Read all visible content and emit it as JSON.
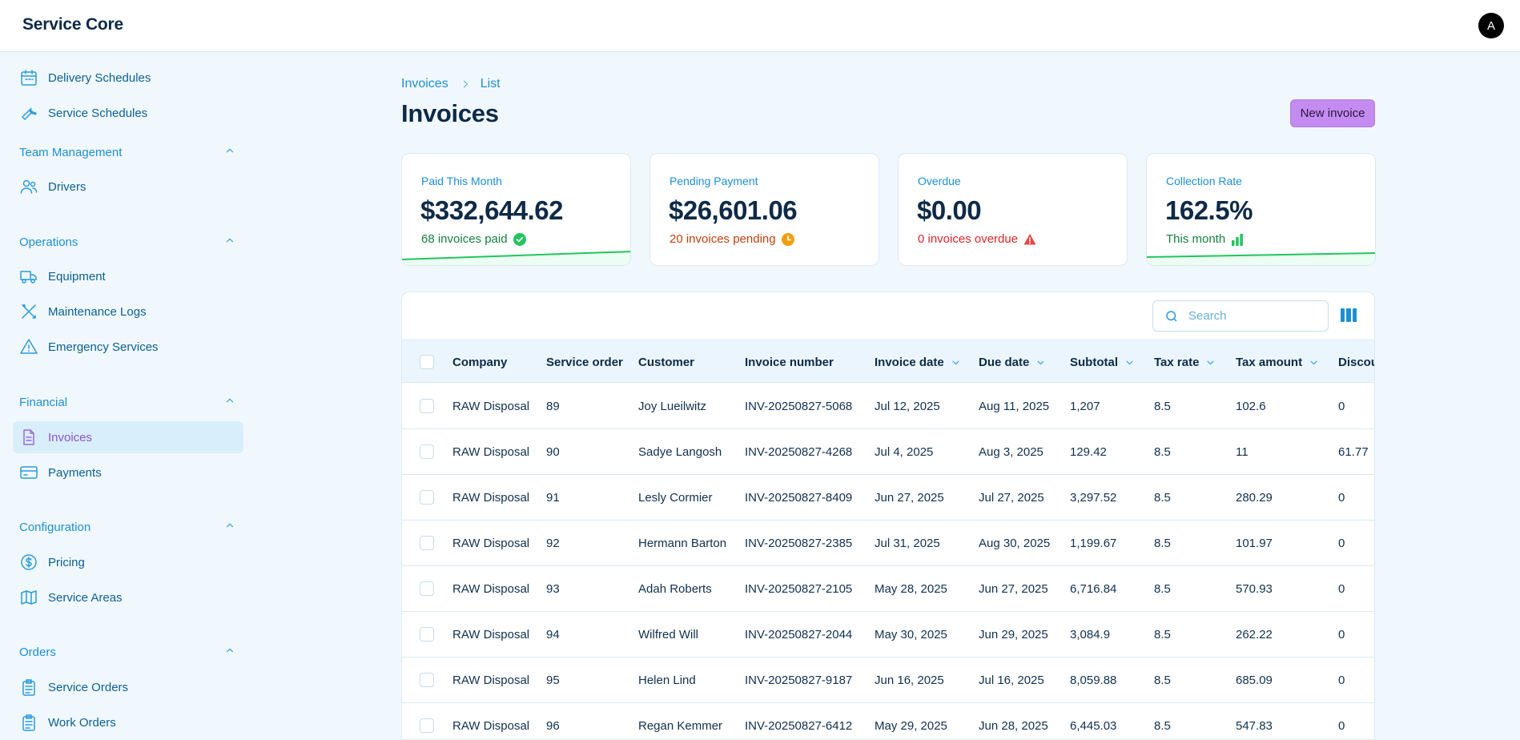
{
  "app": {
    "title": "Service Core",
    "avatar_initial": "A"
  },
  "sidebar": {
    "items_top": [
      {
        "label": "Delivery Schedules",
        "icon": "calendar-icon"
      },
      {
        "label": "Service Schedules",
        "icon": "wrench-icon"
      }
    ],
    "sections": [
      {
        "label": "Team Management",
        "items": [
          {
            "label": "Drivers",
            "icon": "users-icon"
          }
        ]
      },
      {
        "label": "Operations",
        "items": [
          {
            "label": "Equipment",
            "icon": "truck-icon"
          },
          {
            "label": "Maintenance Logs",
            "icon": "tools-icon"
          },
          {
            "label": "Emergency Services",
            "icon": "alert-triangle-icon"
          }
        ]
      },
      {
        "label": "Financial",
        "items": [
          {
            "label": "Invoices",
            "icon": "document-icon",
            "active": true
          },
          {
            "label": "Payments",
            "icon": "credit-card-icon"
          }
        ]
      },
      {
        "label": "Configuration",
        "items": [
          {
            "label": "Pricing",
            "icon": "dollar-circle-icon"
          },
          {
            "label": "Service Areas",
            "icon": "map-icon"
          }
        ]
      },
      {
        "label": "Orders",
        "items": [
          {
            "label": "Service Orders",
            "icon": "clipboard-icon"
          },
          {
            "label": "Work Orders",
            "icon": "clipboard-list-icon"
          }
        ]
      }
    ]
  },
  "breadcrumb": {
    "root": "Invoices",
    "current": "List"
  },
  "page": {
    "title": "Invoices",
    "new_button": "New invoice"
  },
  "stats": [
    {
      "label": "Paid This Month",
      "value": "$332,644.62",
      "sub": "68 invoices paid",
      "sub_color": "#15803d",
      "icon": "check-circle-icon"
    },
    {
      "label": "Pending Payment",
      "value": "$26,601.06",
      "sub": "20 invoices pending",
      "sub_color": "#c2410c",
      "icon": "clock-icon"
    },
    {
      "label": "Overdue",
      "value": "$0.00",
      "sub": "0 invoices overdue",
      "sub_color": "#dc2626",
      "icon": "warning-icon"
    },
    {
      "label": "Collection Rate",
      "value": "162.5%",
      "sub": "This month",
      "sub_color": "#15803d",
      "icon": "bar-chart-icon"
    }
  ],
  "colors": {
    "accent": "#1d8fd3",
    "button": "#c48bf0",
    "active_nav": "#8a55c9",
    "spark": "#22c55e"
  },
  "table": {
    "search_placeholder": "Search",
    "columns": [
      {
        "label": "Company",
        "sortable": false
      },
      {
        "label": "Service order",
        "sortable": false
      },
      {
        "label": "Customer",
        "sortable": false
      },
      {
        "label": "Invoice number",
        "sortable": false
      },
      {
        "label": "Invoice date",
        "sortable": true
      },
      {
        "label": "Due date",
        "sortable": true
      },
      {
        "label": "Subtotal",
        "sortable": true
      },
      {
        "label": "Tax rate",
        "sortable": true
      },
      {
        "label": "Tax amount",
        "sortable": true
      },
      {
        "label": "Discou",
        "sortable": false
      }
    ],
    "rows": [
      [
        "RAW Disposal",
        "89",
        "Joy Lueilwitz",
        "INV-20250827-5068",
        "Jul 12, 2025",
        "Aug 11, 2025",
        "1,207",
        "8.5",
        "102.6",
        "0"
      ],
      [
        "RAW Disposal",
        "90",
        "Sadye Langosh",
        "INV-20250827-4268",
        "Jul 4, 2025",
        "Aug 3, 2025",
        "129.42",
        "8.5",
        "11",
        "61.77"
      ],
      [
        "RAW Disposal",
        "91",
        "Lesly Cormier",
        "INV-20250827-8409",
        "Jun 27, 2025",
        "Jul 27, 2025",
        "3,297.52",
        "8.5",
        "280.29",
        "0"
      ],
      [
        "RAW Disposal",
        "92",
        "Hermann Barton",
        "INV-20250827-2385",
        "Jul 31, 2025",
        "Aug 30, 2025",
        "1,199.67",
        "8.5",
        "101.97",
        "0"
      ],
      [
        "RAW Disposal",
        "93",
        "Adah Roberts",
        "INV-20250827-2105",
        "May 28, 2025",
        "Jun 27, 2025",
        "6,716.84",
        "8.5",
        "570.93",
        "0"
      ],
      [
        "RAW Disposal",
        "94",
        "Wilfred Will",
        "INV-20250827-2044",
        "May 30, 2025",
        "Jun 29, 2025",
        "3,084.9",
        "8.5",
        "262.22",
        "0"
      ],
      [
        "RAW Disposal",
        "95",
        "Helen Lind",
        "INV-20250827-9187",
        "Jun 16, 2025",
        "Jul 16, 2025",
        "8,059.88",
        "8.5",
        "685.09",
        "0"
      ],
      [
        "RAW Disposal",
        "96",
        "Regan Kemmer",
        "INV-20250827-6412",
        "May 29, 2025",
        "Jun 28, 2025",
        "6,445.03",
        "8.5",
        "547.83",
        "0"
      ]
    ]
  }
}
